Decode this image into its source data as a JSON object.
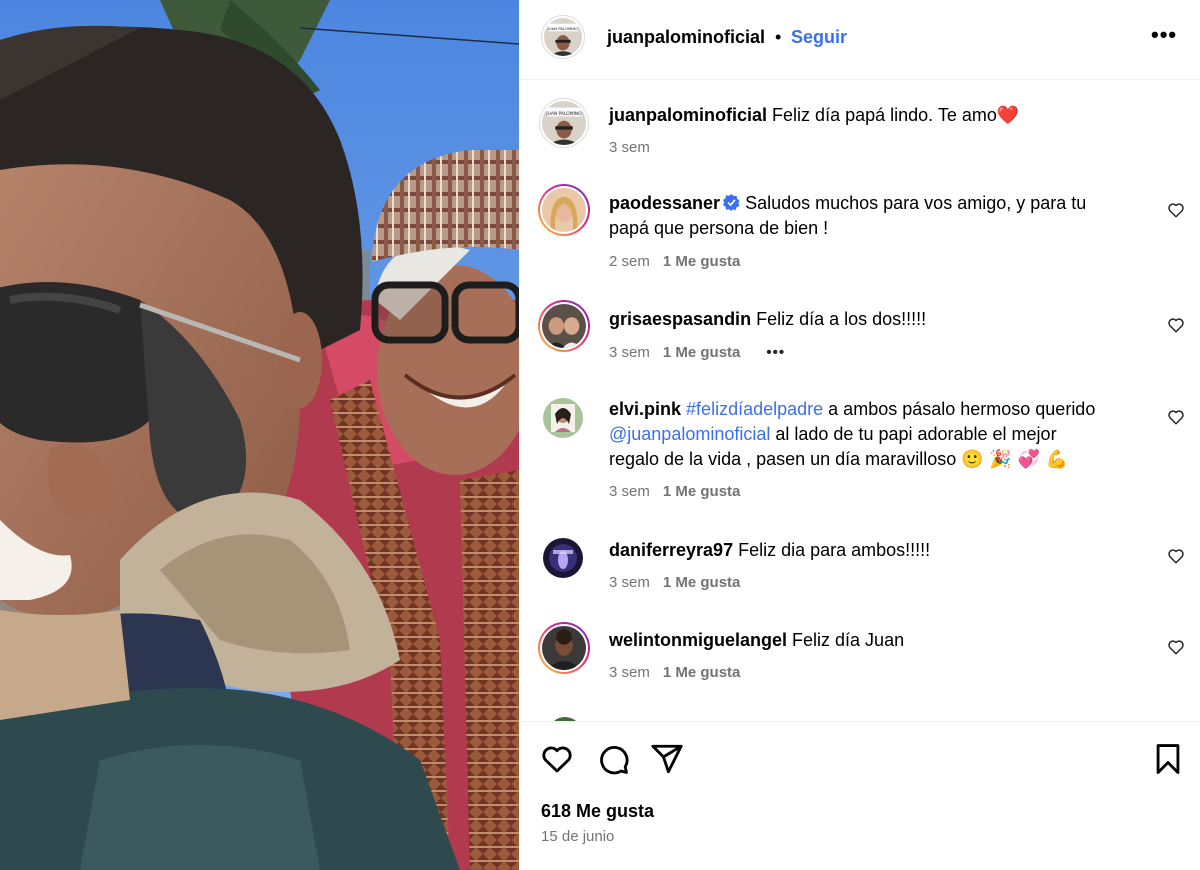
{
  "header": {
    "username": "juanpalominoficial",
    "separator": "•",
    "follow_label": "Seguir",
    "more_icon": "more-horizontal-icon",
    "more_label": "•••"
  },
  "caption": {
    "username": "juanpalominoficial",
    "text": "Feliz día papá lindo. Te amo",
    "heart_emoji": "❤️",
    "time": "3 sem"
  },
  "comments": [
    {
      "username": "paodessaner",
      "verified": true,
      "line1": "Saludos muchos para vos amigo, y para tu",
      "line2": "papá que persona de bien !",
      "time": "2 sem",
      "likes": "1 Me gusta"
    },
    {
      "username": "grisaespasandin",
      "text": "Feliz día a los dos!!!!!",
      "time": "3 sem",
      "likes": "1 Me gusta",
      "more": "•••"
    },
    {
      "username": "elvi.pink",
      "hashtag": "#felizdíadelpadre",
      "text_after_hashtag": "a ambos pásalo hermoso querido",
      "mention": "@juanpalominoficial",
      "line2_rest": "al lado de tu papi adorable el mejor",
      "line3": "regalo de la vida , pasen un día maravilloso",
      "emojis": "🙂 🎉 💞 💪",
      "time": "3 sem",
      "likes": "1 Me gusta"
    },
    {
      "username": "daniferreyra97",
      "text": "Feliz dia para ambos!!!!!",
      "time": "3 sem",
      "likes": "1 Me gusta"
    },
    {
      "username": "welintonmiguelangel",
      "text": "Feliz día Juan",
      "time": "3 sem",
      "likes": "1 Me gusta"
    }
  ],
  "footer": {
    "likes_count": "618 Me gusta",
    "date": "15 de junio",
    "icons": [
      "heart-icon",
      "comment-icon",
      "share-icon",
      "bookmark-icon"
    ]
  },
  "colors": {
    "link": "#3a6ff0",
    "meta": "#737373",
    "border": "#efefef"
  }
}
